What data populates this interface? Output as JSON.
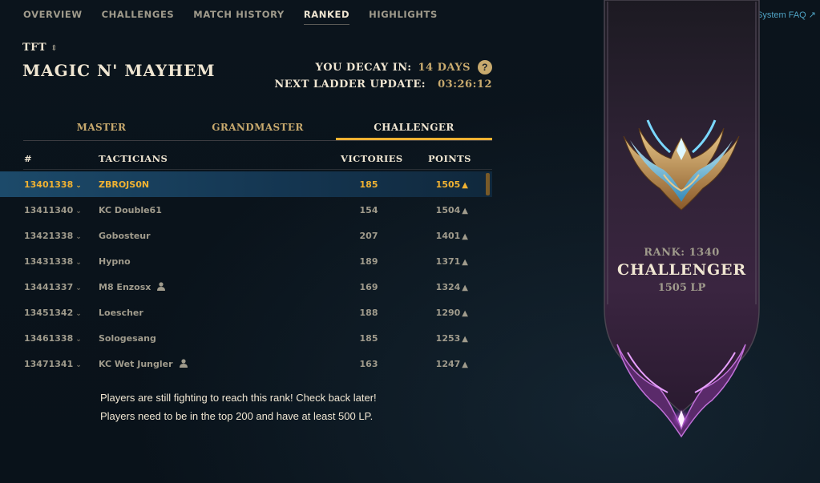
{
  "nav": {
    "items": [
      "OVERVIEW",
      "CHALLENGES",
      "MATCH HISTORY",
      "RANKED",
      "HIGHLIGHTS"
    ],
    "active": "RANKED"
  },
  "faq_link": "TFT League System FAQ ↗",
  "queue": {
    "label": "TFT",
    "icon": "up-down-chevron-icon"
  },
  "set_title": "MAGIC N' MAYHEM",
  "decay": {
    "label": "YOU DECAY IN:",
    "value": "14 DAYS",
    "help": "?"
  },
  "ladder_update": {
    "label": "NEXT LADDER UPDATE:",
    "value": "03:26:12"
  },
  "tiers": {
    "items": [
      "MASTER",
      "GRANDMASTER",
      "CHALLENGER"
    ],
    "active": "CHALLENGER"
  },
  "table": {
    "headers": {
      "rank": "#",
      "name": "TACTICIANS",
      "victories": "VICTORIES",
      "points": "POINTS"
    },
    "rows": [
      {
        "rank": "13401338",
        "name": "ZBROJS0N",
        "victories": "185",
        "points": "1505",
        "self": true,
        "friend": false
      },
      {
        "rank": "13411340",
        "name": "KC Double61",
        "victories": "154",
        "points": "1504",
        "self": false,
        "friend": false
      },
      {
        "rank": "13421338",
        "name": "Gobosteur",
        "victories": "207",
        "points": "1401",
        "self": false,
        "friend": false
      },
      {
        "rank": "13431338",
        "name": "Hypno",
        "victories": "189",
        "points": "1371",
        "self": false,
        "friend": false
      },
      {
        "rank": "13441337",
        "name": "M8 Enzosx",
        "victories": "169",
        "points": "1324",
        "self": false,
        "friend": true
      },
      {
        "rank": "13451342",
        "name": "Loescher",
        "victories": "188",
        "points": "1290",
        "self": false,
        "friend": false
      },
      {
        "rank": "13461338",
        "name": "Sologesang",
        "victories": "185",
        "points": "1253",
        "self": false,
        "friend": false
      },
      {
        "rank": "13471341",
        "name": "KC Wet Jungler",
        "victories": "163",
        "points": "1247",
        "self": false,
        "friend": true
      }
    ]
  },
  "note": {
    "line1": "Players are still fighting to reach this rank! Check back later!",
    "line2": "Players need to be in the top 200 and have at least 500 LP."
  },
  "rank_card": {
    "rank": "RANK: 1340",
    "tier": "CHALLENGER",
    "lp": "1505 LP",
    "emblem": "challenger-emblem-icon"
  },
  "colors": {
    "gold": "#c8aa6e",
    "highlight_gold": "#f0b232",
    "text_light": "#f0e6d2",
    "text_muted": "#a09b8c",
    "link": "#4fa3c4",
    "self_row": "#1c4a6a",
    "banner": "#3a2540"
  }
}
